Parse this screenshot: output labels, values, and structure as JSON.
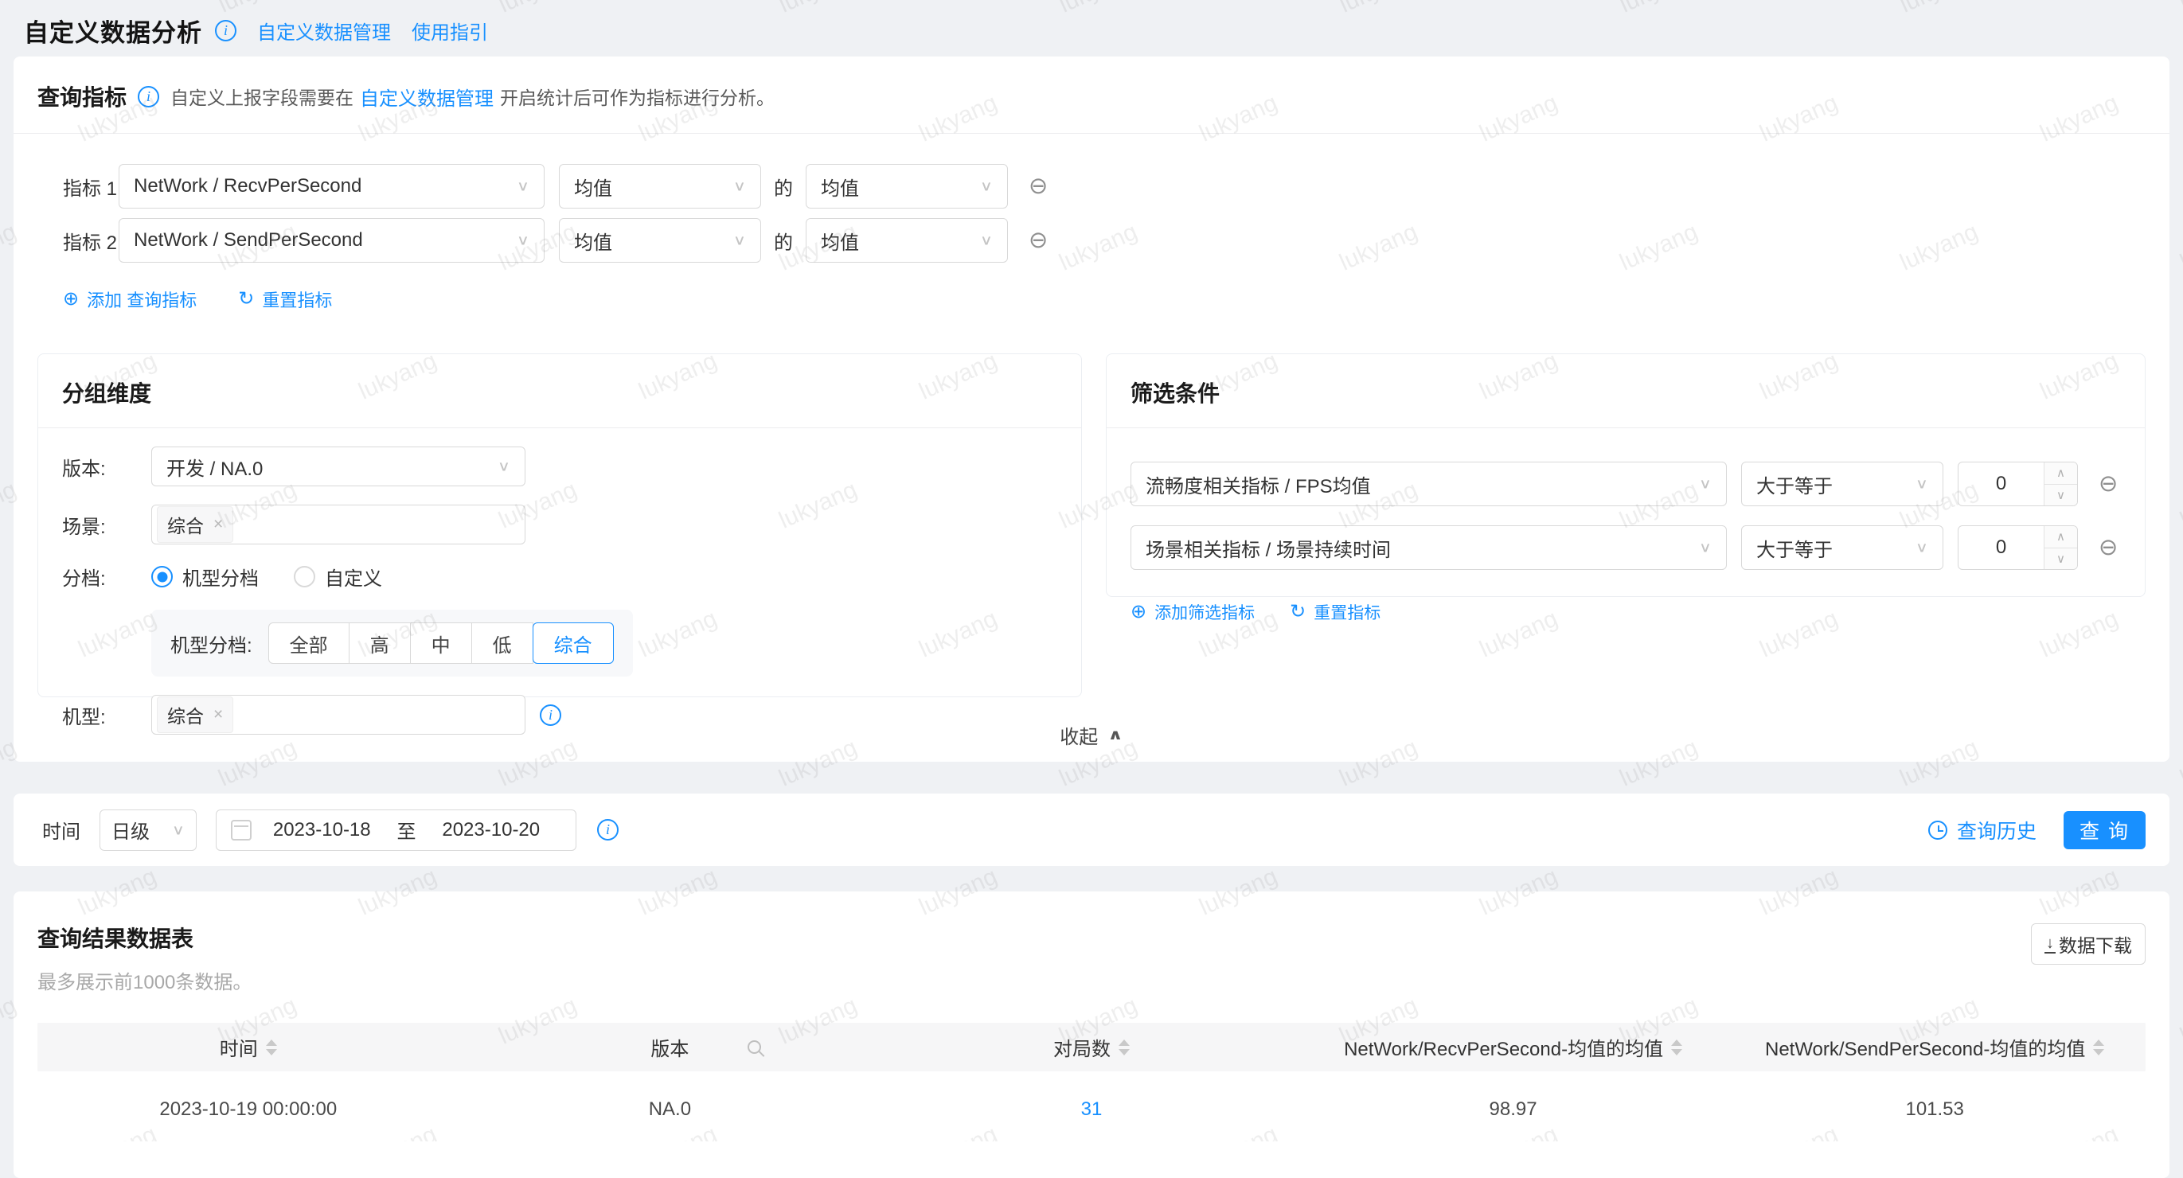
{
  "watermark": {
    "text": "lukyang"
  },
  "icons": {
    "plus": "⊕",
    "minus": "⊖",
    "caret_down": "∨",
    "caret_up": "∧",
    "refresh": "↻",
    "collapse": "∧",
    "close": "×",
    "down_arrow": "↓",
    "info": "i"
  },
  "header": {
    "title": "自定义数据分析",
    "links": [
      {
        "label": "自定义数据管理"
      },
      {
        "label": "使用指引"
      }
    ]
  },
  "query_metrics": {
    "title": "查询指标",
    "hint_prefix": "自定义上报字段需要在",
    "hint_link": "自定义数据管理",
    "hint_suffix": "开启统计后可作为指标进行分析。",
    "rows": [
      {
        "label": "指标 1",
        "metric": "NetWork / RecvPerSecond",
        "agg1": "均值",
        "conj": "的",
        "agg2": "均值"
      },
      {
        "label": "指标 2",
        "metric": "NetWork / SendPerSecond",
        "agg1": "均值",
        "conj": "的",
        "agg2": "均值"
      }
    ],
    "add_label": "添加 查询指标",
    "reset_label": "重置指标"
  },
  "group_dims": {
    "title": "分组维度",
    "version_label": "版本:",
    "version_value": "开发 / NA.0",
    "scene_label": "场景:",
    "scene_tag": "综合",
    "tier_label": "分档:",
    "radios": [
      {
        "label": "机型分档",
        "selected": true
      },
      {
        "label": "自定义",
        "selected": false
      }
    ],
    "tier_group_label": "机型分档:",
    "tier_buttons": [
      {
        "label": "全部",
        "selected": false
      },
      {
        "label": "高",
        "selected": false
      },
      {
        "label": "中",
        "selected": false
      },
      {
        "label": "低",
        "selected": false
      },
      {
        "label": "综合",
        "selected": true
      }
    ],
    "model_label": "机型:",
    "model_tag": "综合"
  },
  "filters": {
    "title": "筛选条件",
    "rows": [
      {
        "metric": "流畅度相关指标 / FPS均值",
        "op": "大于等于",
        "value": "0"
      },
      {
        "metric": "场景相关指标 / 场景持续时间",
        "op": "大于等于",
        "value": "0"
      }
    ],
    "add_label": "添加筛选指标",
    "reset_label": "重置指标"
  },
  "collapse_label": "收起",
  "time_bar": {
    "label": "时间",
    "granularity": "日级",
    "date_start": "2023-10-18",
    "date_sep": "至",
    "date_end": "2023-10-20",
    "history_label": "查询历史",
    "query_label": "查 询"
  },
  "results": {
    "title": "查询结果数据表",
    "subtitle": "最多展示前1000条数据。",
    "download_label": "数据下载",
    "table": {
      "columns": [
        {
          "label": "时间"
        },
        {
          "label": "版本"
        },
        {
          "label": "对局数"
        },
        {
          "label": "NetWork/RecvPerSecond-均值的均值"
        },
        {
          "label": "NetWork/SendPerSecond-均值的均值"
        }
      ],
      "rows": [
        {
          "time": "2023-10-19 00:00:00",
          "version": "NA.0",
          "matches": "31",
          "recv": "98.97",
          "send": "101.53"
        }
      ]
    }
  },
  "colors": {
    "accent": "#1890ff"
  }
}
